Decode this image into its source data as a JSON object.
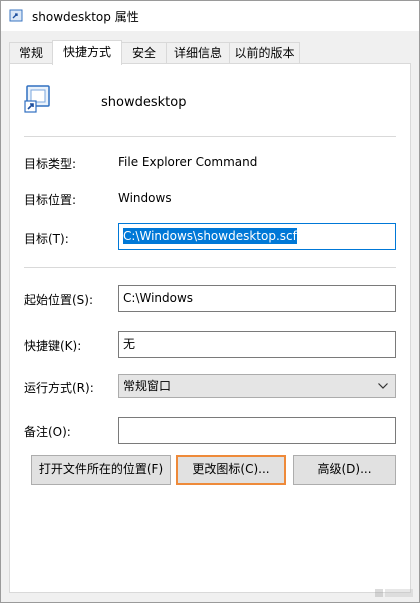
{
  "window": {
    "title": "showdesktop 属性"
  },
  "tabs": [
    {
      "label": "常规"
    },
    {
      "label": "快捷方式"
    },
    {
      "label": "安全"
    },
    {
      "label": "详细信息"
    },
    {
      "label": "以前的版本"
    }
  ],
  "active_tab": "快捷方式",
  "shortcut": {
    "name": "showdesktop",
    "target_type_label": "目标类型:",
    "target_type_value": "File Explorer Command",
    "target_location_label": "目标位置:",
    "target_location_value": "Windows",
    "target_label": "目标(T):",
    "target_value": "C:\\Windows\\showdesktop.scf",
    "start_in_label": "起始位置(S):",
    "start_in_value": "C:\\Windows",
    "hotkey_label": "快捷键(K):",
    "hotkey_value": "无",
    "run_label": "运行方式(R):",
    "run_value": "常规窗口",
    "comment_label": "备注(O):",
    "comment_value": ""
  },
  "buttons": {
    "open_location": "打开文件所在的位置(F)",
    "change_icon": "更改图标(C)...",
    "advanced": "高级(D)..."
  },
  "colors": {
    "selection": "#0078d7",
    "focus_highlight": "#ee8a3a"
  },
  "icons": {
    "app": "shortcut-icon",
    "dropdown": "chevron-down-icon"
  }
}
